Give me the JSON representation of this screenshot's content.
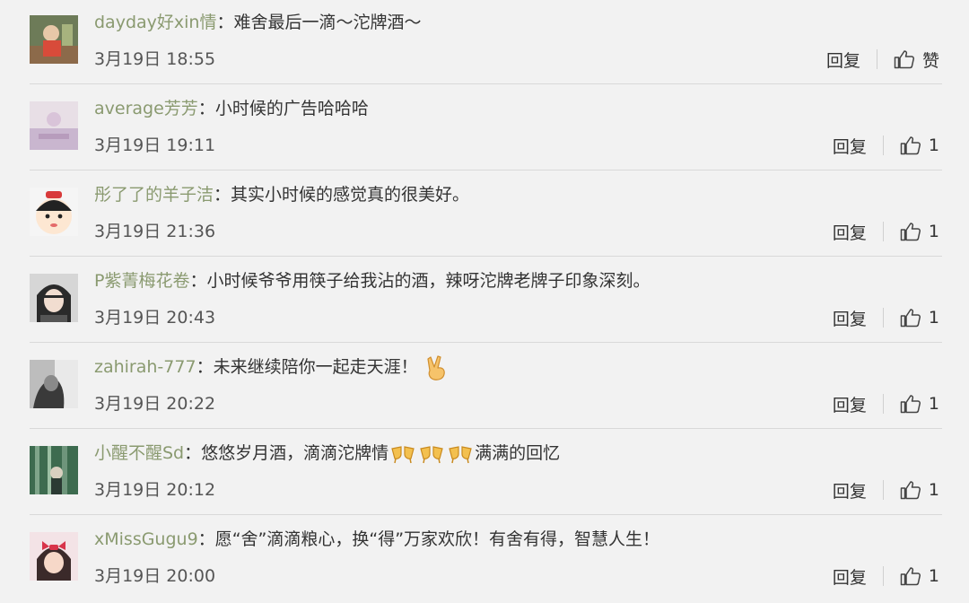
{
  "comments": [
    {
      "user": "dayday好xin情",
      "sep": "：",
      "text": "难舍最后一滴～沱牌酒～",
      "date": "3月19日 18:55",
      "reply": "回复",
      "like": "赞",
      "avatar": "avatar-1"
    },
    {
      "user": "average芳芳",
      "sep": "：",
      "text": "小时候的广告哈哈哈",
      "date": "3月19日 19:11",
      "reply": "回复",
      "like": "1",
      "avatar": "avatar-2"
    },
    {
      "user": "彤了了的羊子洁",
      "sep": "：",
      "text": "其实小时候的感觉真的很美好。",
      "date": "3月19日 21:36",
      "reply": "回复",
      "like": "1",
      "avatar": "avatar-3"
    },
    {
      "user": "P紫菁梅花卷",
      "sep": "：",
      "text": "小时候爷爷用筷子给我沾的酒，辣呀沱牌老牌子印象深刻。",
      "date": "3月19日 20:43",
      "reply": "回复",
      "like": "1",
      "avatar": "avatar-4"
    },
    {
      "user": "zahirah-777",
      "sep": "：",
      "text": "未来继续陪你一起走天涯！",
      "date": "3月19日 20:22",
      "reply": "回复",
      "like": "1",
      "avatar": "avatar-5",
      "emoji_after": "victory-hand-emoji"
    },
    {
      "user": "小醒不醒Sd",
      "sep": "：",
      "text_a": "悠悠岁月酒，滴滴沱牌情",
      "text_b": "满满的回忆",
      "date": "3月19日 20:12",
      "reply": "回复",
      "like": "1",
      "avatar": "avatar-6",
      "emoji_mid": "cheers-emoji"
    },
    {
      "user": "xMissGugu9",
      "sep": "：",
      "text": "愿“舍”滴滴粮心，换“得”万家欢欣！有舍有得，智慧人生！",
      "date": "3月19日 20:00",
      "reply": "回复",
      "like": "1",
      "avatar": "avatar-7"
    }
  ]
}
